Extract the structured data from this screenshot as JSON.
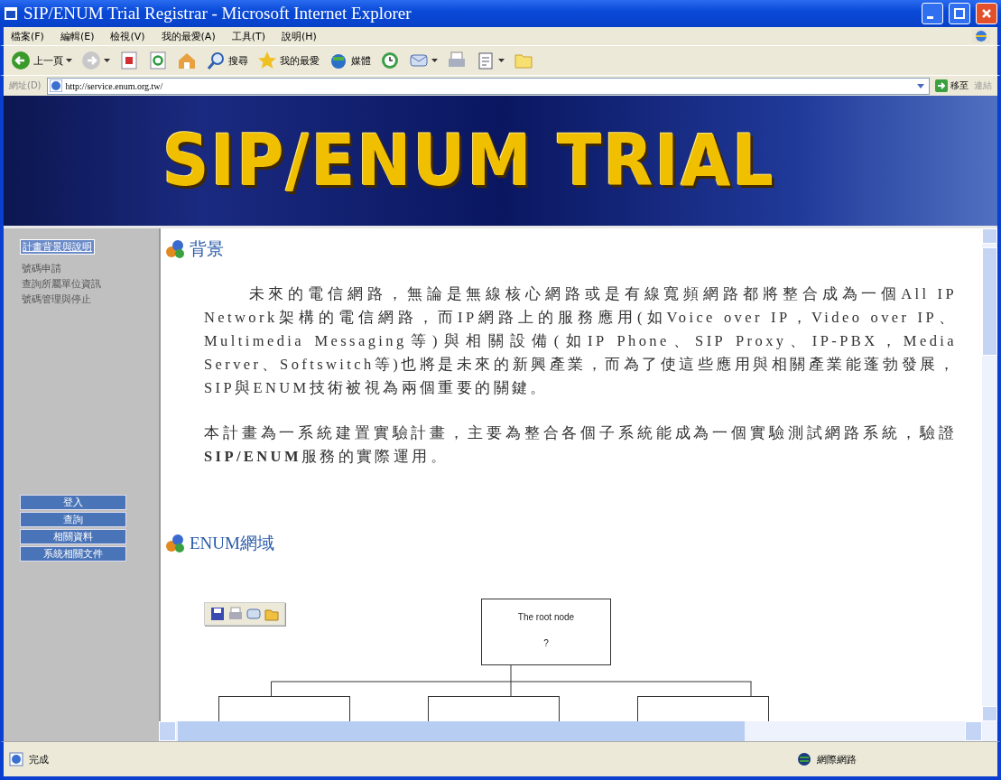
{
  "window": {
    "title": "SIP/ENUM Trial Registrar - Microsoft Internet Explorer"
  },
  "menu": [
    "檔案(F)",
    "編輯(E)",
    "檢視(V)",
    "我的最愛(A)",
    "工具(T)",
    "說明(H)"
  ],
  "toolbar": [
    {
      "kind": "back",
      "label": "上一頁"
    },
    {
      "kind": "forward"
    },
    {
      "kind": "stop"
    },
    {
      "kind": "refresh"
    },
    {
      "kind": "home"
    },
    {
      "kind": "search",
      "label": "搜尋"
    },
    {
      "kind": "favorites",
      "label": "我的最愛"
    },
    {
      "kind": "media",
      "label": "媒體"
    },
    {
      "kind": "history"
    },
    {
      "kind": "mail"
    },
    {
      "kind": "print"
    },
    {
      "kind": "edit"
    },
    {
      "kind": "folder"
    }
  ],
  "address": {
    "label": "網址(D)",
    "value": "http://service.enum.org.tw/",
    "go": "移至",
    "links": "連結"
  },
  "banner": {
    "title": "SIP/ENUM TRIAL"
  },
  "sidebar": {
    "links": [
      {
        "label": "計畫背景與說明",
        "selected": true
      },
      {
        "label": "號碼申請",
        "selected": false
      },
      {
        "label": "查詢所屬單位資訊",
        "selected": false
      },
      {
        "label": "號碼管理與停止",
        "selected": false
      }
    ],
    "buttons": [
      "登入",
      "查詢",
      "相關資料",
      "系統相關文件"
    ]
  },
  "content": {
    "sections": [
      {
        "heading": "背景",
        "paragraphs": [
          {
            "indent": true,
            "text": "未來的電信網路，無論是無線核心網路或是有線寬頻網路都將整合成為一個All IP Network架構的電信網路，而IP網路上的服務應用(如Voice over IP，Video over IP、Multimedia Messaging等)與相關設備(如IP Phone、SIP Proxy、IP-PBX，Media Server、Softswitch等)也將是未來的新興產業，而為了使這些應用與相關產業能蓬勃發展，SIP與ENUM技術被視為兩個重要的關鍵。"
          },
          {
            "indent": false,
            "text": "本計畫為一系統建置實驗計畫，主要為整合各個子系統能成為一個實驗測試網路系統，驗證**SIP/ENUM**服務的實際運用。"
          }
        ]
      },
      {
        "heading": "ENUM網域"
      }
    ],
    "diagram": {
      "root_title": "The root node",
      "root_value": "?"
    }
  },
  "status": {
    "text": "完成",
    "zone": "網際網路"
  }
}
